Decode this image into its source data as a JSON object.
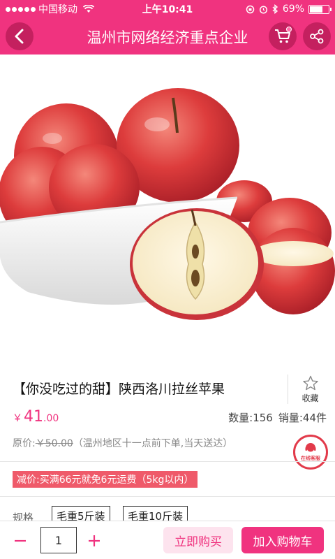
{
  "status_bar": {
    "carrier": "中国移动",
    "time": "上午10:41",
    "battery": "69%",
    "battery_level": 0.69
  },
  "nav": {
    "title": "温州市网络经济重点企业",
    "icons": [
      "back-arrow-icon",
      "cart-icon",
      "share-icon"
    ]
  },
  "product": {
    "title": "【你没吃过的甜】陕西洛川拉丝苹果",
    "favorite_label": "收藏",
    "price_symbol": "￥",
    "price_int": "41",
    "price_dec": ".00",
    "quantity_stat": "数量:156",
    "sales_stat": "销量:44件",
    "original_label": "原价:",
    "original_price": "￥50.00",
    "delivery_note": "（温州地区十一点前下单,当天送达）",
    "service_label": "在线客服",
    "promo": "减价:买满66元就免6元运费（5kg以内）"
  },
  "spec": {
    "label": "规格",
    "options": [
      "毛重5斤装",
      "毛重10斤装"
    ]
  },
  "bottom_bar": {
    "quantity": "1",
    "buy_now": "立即购买",
    "add_to_cart": "加入购物车"
  },
  "colors": {
    "brand": "#f0337f",
    "promo": "#ef5a6a"
  }
}
